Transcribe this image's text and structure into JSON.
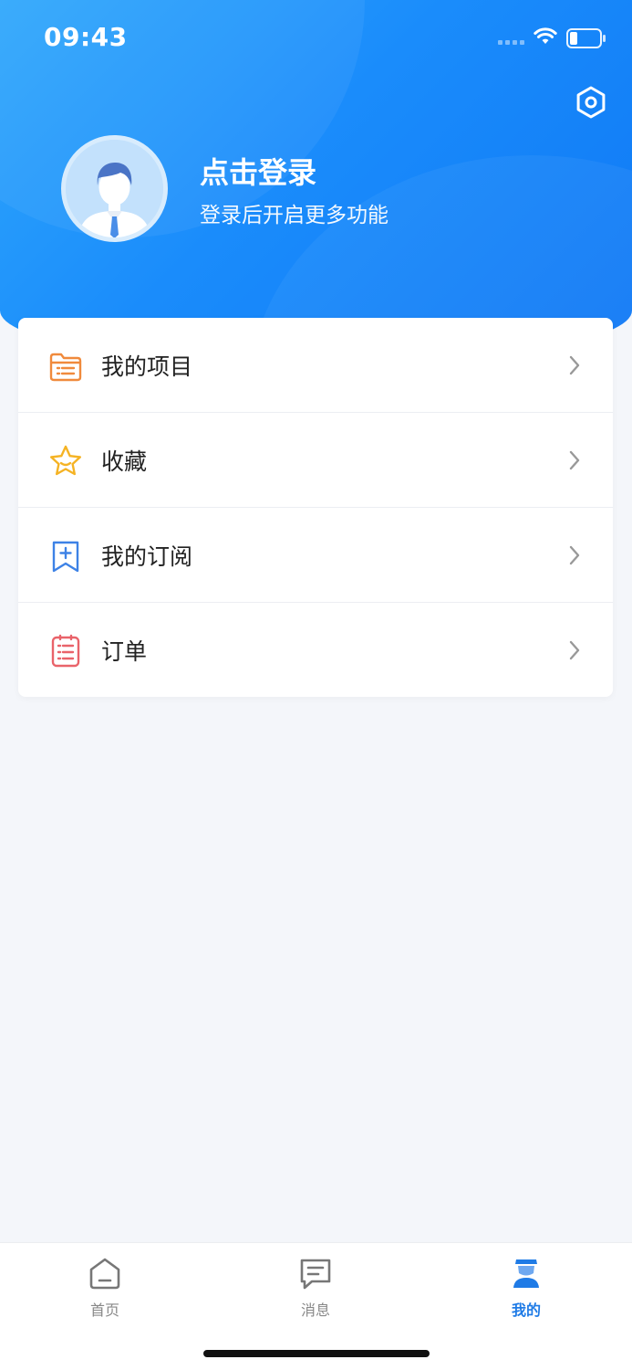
{
  "status_bar": {
    "time": "09:43"
  },
  "profile": {
    "title": "点击登录",
    "subtitle": "登录后开启更多功能"
  },
  "menu": {
    "items": [
      {
        "label": "我的项目",
        "icon": "folder-icon",
        "color": "#f08a3c"
      },
      {
        "label": "收藏",
        "icon": "star-icon",
        "color": "#f5b324"
      },
      {
        "label": "我的订阅",
        "icon": "bookmark-plus-icon",
        "color": "#3d82e6"
      },
      {
        "label": "订单",
        "icon": "order-list-icon",
        "color": "#e9636a"
      }
    ]
  },
  "tabbar": {
    "tabs": [
      {
        "label": "首页",
        "icon": "home-icon",
        "active": false
      },
      {
        "label": "消息",
        "icon": "message-icon",
        "active": false
      },
      {
        "label": "我的",
        "icon": "profile-icon",
        "active": true
      }
    ]
  },
  "colors": {
    "brand": "#1a8cfb",
    "tab_active": "#1f7be6",
    "tab_inactive": "#888888"
  }
}
